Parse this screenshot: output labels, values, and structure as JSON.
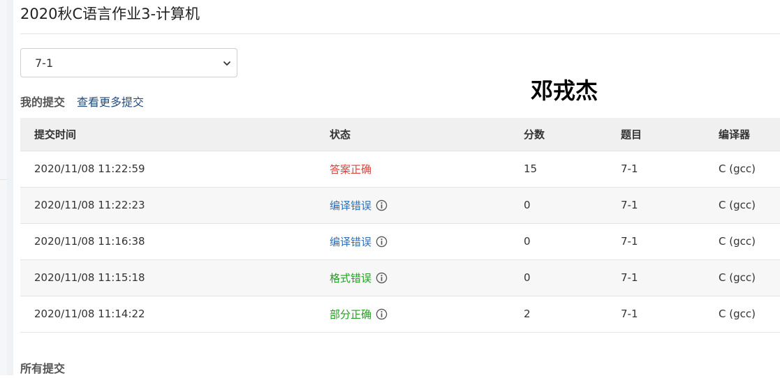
{
  "page": {
    "title": "2020秋C语言作业3-计算机",
    "watermark": "邓戎杰"
  },
  "problem_select": {
    "value": "7-1"
  },
  "my_submissions": {
    "heading": "我的提交",
    "more_link": "查看更多提交"
  },
  "table": {
    "headers": [
      "提交时间",
      "状态",
      "分数",
      "题目",
      "编译器"
    ],
    "rows": [
      {
        "time": "2020/11/08 11:22:59",
        "status": "答案正确",
        "status_color": "#e0423b",
        "has_info": false,
        "score": "15",
        "problem": "7-1",
        "compiler": "C (gcc)"
      },
      {
        "time": "2020/11/08 11:22:23",
        "status": "编译错误",
        "status_color": "#2f6fb5",
        "has_info": true,
        "score": "0",
        "problem": "7-1",
        "compiler": "C (gcc)"
      },
      {
        "time": "2020/11/08 11:16:38",
        "status": "编译错误",
        "status_color": "#2f6fb5",
        "has_info": true,
        "score": "0",
        "problem": "7-1",
        "compiler": "C (gcc)"
      },
      {
        "time": "2020/11/08 11:15:18",
        "status": "格式错误",
        "status_color": "#22a022",
        "has_info": true,
        "score": "0",
        "problem": "7-1",
        "compiler": "C (gcc)"
      },
      {
        "time": "2020/11/08 11:14:22",
        "status": "部分正确",
        "status_color": "#22a022",
        "has_info": true,
        "score": "2",
        "problem": "7-1",
        "compiler": "C (gcc)"
      }
    ]
  },
  "all_submissions": {
    "heading": "所有提交"
  },
  "icons": {
    "select_arrow": "chevron-down-icon",
    "status_info": "info-circle-icon"
  }
}
